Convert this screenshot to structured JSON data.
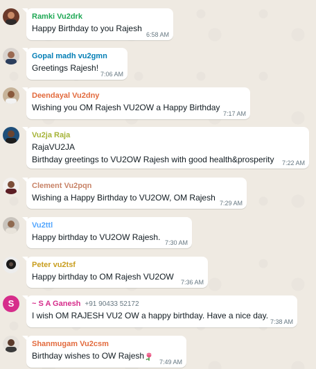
{
  "colors": {
    "chat_background": "#efeae2",
    "bubble": "#ffffff",
    "text": "#111b21",
    "meta": "#667781"
  },
  "messages": [
    {
      "sender": "Ramki Vu2drk",
      "sender_color": "#1fa855",
      "text": "Happy Birthday to you Rajesh",
      "time": "6:58 AM",
      "avatar": "photo"
    },
    {
      "sender": "Gopal madh vu2gmn",
      "sender_color": "#027eb5",
      "text": "Greetings Rajesh!",
      "time": "7:06 AM",
      "avatar": "photo"
    },
    {
      "sender": "Deendayal Vu2dny",
      "sender_color": "#e26a3d",
      "text": "Wishing you OM Rajesh VU2OW a Happy Birthday",
      "time": "7:17 AM",
      "avatar": "photo"
    },
    {
      "sender": "Vu2ja Raja",
      "sender_color": "#a5b337",
      "text_line1": "RajaVU2JA",
      "text": "Birthday greetings to VU2OW Rajesh with good health&prosperity",
      "time": "7:22 AM",
      "avatar": "photo"
    },
    {
      "sender": "Clement Vu2pqn",
      "sender_color": "#c88367",
      "text": "Wishing a Happy Birthday to VU2OW, OM Rajesh",
      "time": "7:29 AM",
      "avatar": "photo"
    },
    {
      "sender": "Vu2ttl",
      "sender_color": "#53a6fd",
      "text": "Happy birthday to VU2OW Rajesh.",
      "time": "7:30 AM",
      "avatar": "photo"
    },
    {
      "sender": "Peter vu2tsf",
      "sender_color": "#c89d1d",
      "text": "Happy birthday to OM Rajesh  VU2OW",
      "time": "7:36 AM",
      "avatar": "photo"
    },
    {
      "sender": "~ S A Ganesh",
      "phone": "+91 90433 52172",
      "sender_color": "#d62d8b",
      "text": "I wish OM RAJESH VU2 OW   a happy birthday. Have a nice day.",
      "time": "7:38 AM",
      "avatar": "S",
      "avatar_color": "#d62d8b"
    },
    {
      "sender": "Shanmugam Vu2csm",
      "sender_color": "#e26a3d",
      "text": "Birthday wishes to OW Rajesh",
      "time": "7:49 AM",
      "avatar": "photo",
      "emoji": "wilted-flower-icon"
    }
  ]
}
